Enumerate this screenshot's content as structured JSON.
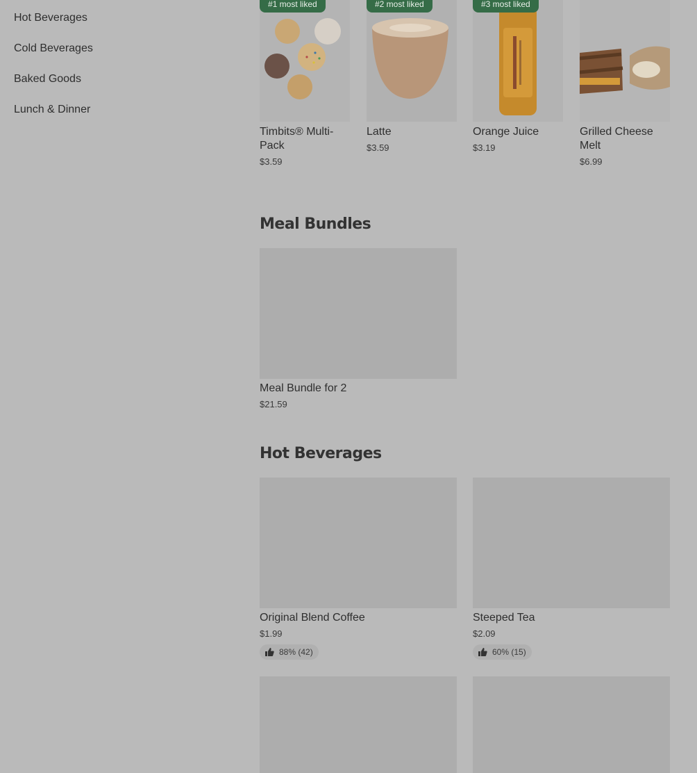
{
  "sidebar": {
    "items": [
      {
        "label": "Hot Beverages"
      },
      {
        "label": "Cold Beverages"
      },
      {
        "label": "Baked Goods"
      },
      {
        "label": "Lunch & Dinner"
      }
    ]
  },
  "most_liked": [
    {
      "badge": "#1 most liked",
      "name": "Timbits® Multi-Pack",
      "price": "$3.59",
      "image": "timbits-image"
    },
    {
      "badge": "#2 most liked",
      "name": "Latte",
      "price": "$3.59",
      "image": "latte-image"
    },
    {
      "badge": "#3 most liked",
      "name": "Orange Juice",
      "price": "$3.19",
      "image": "orange-juice-image"
    },
    {
      "name": "Grilled Cheese Melt",
      "price": "$6.99",
      "image": "grilled-cheese-image"
    }
  ],
  "meal_bundles": {
    "title": "Meal Bundles",
    "items": [
      {
        "name": "Meal Bundle for 2",
        "price": "$21.59"
      }
    ]
  },
  "hot_beverages": {
    "title": "Hot Beverages",
    "items": [
      {
        "name": "Original Blend Coffee",
        "price": "$1.99",
        "rating": "88% (42)"
      },
      {
        "name": "Steeped Tea",
        "price": "$2.09",
        "rating": "60% (15)"
      }
    ]
  },
  "colors": {
    "overlay_bg": "#bababa",
    "badge_green": "#356c47",
    "placeholder": "#adadad"
  }
}
